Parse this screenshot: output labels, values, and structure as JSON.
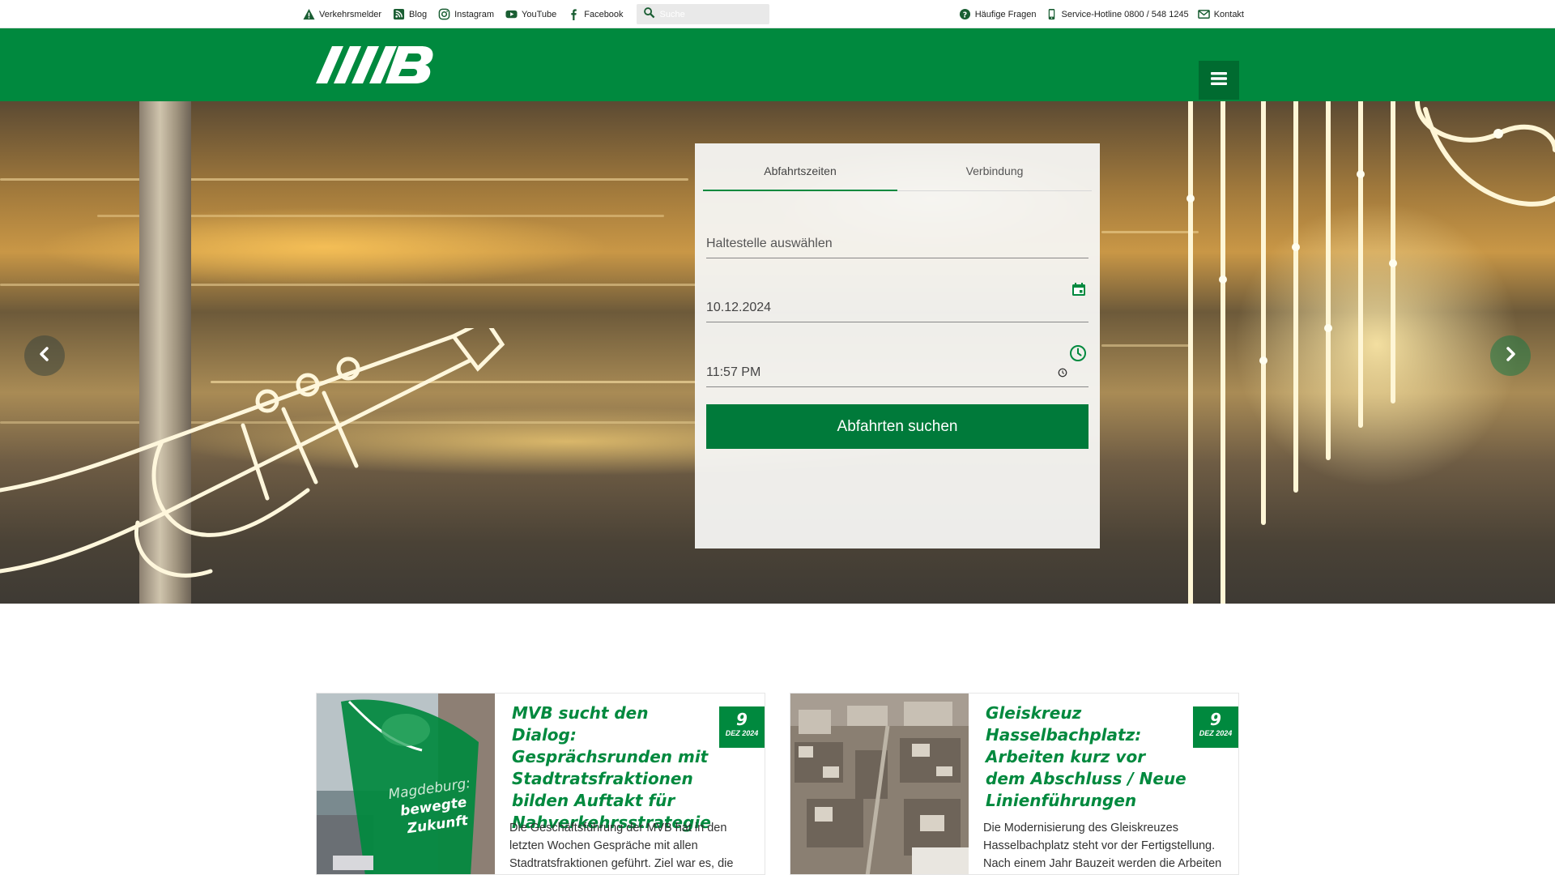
{
  "topbar": {
    "links_left": [
      {
        "label": "Verkehrsmelder",
        "icon": "warning-icon"
      },
      {
        "label": "Blog",
        "icon": "rss-icon"
      },
      {
        "label": "Instagram",
        "icon": "instagram-icon"
      },
      {
        "label": "YouTube",
        "icon": "youtube-icon"
      },
      {
        "label": "Facebook",
        "icon": "facebook-icon"
      }
    ],
    "search_placeholder": "Suche",
    "links_right": [
      {
        "label": "Häufige Fragen",
        "icon": "help-icon"
      },
      {
        "label": "Service-Hotline 0800 / 548 1245",
        "icon": "phone-icon"
      },
      {
        "label": "Kontakt",
        "icon": "mail-icon"
      }
    ]
  },
  "header": {
    "logo_text": "MVB",
    "brand_color": "#00893e"
  },
  "search_panel": {
    "tabs": [
      {
        "label": "Abfahrtszeiten",
        "active": true
      },
      {
        "label": "Verbindung",
        "active": false
      }
    ],
    "stop_placeholder": "Haltestelle auswählen",
    "date_value": "10.12.2024",
    "time_value": "11:57 PM",
    "submit_label": "Abfahrten suchen"
  },
  "news": [
    {
      "title": "MVB sucht den Dialog: Gesprächsrunden mit Stadtratsfraktionen bilden Auftakt für Nahverkehrsstrategie",
      "day": "9",
      "month_year": "DEZ 2024",
      "teaser": "Die Geschäftsführung der MVB hat in den letzten Wochen Gespräche mit allen Stadtratsfraktionen geführt. Ziel war es, die",
      "image_text": "Magdeburg: bewegte Zukunft"
    },
    {
      "title": "Gleiskreuz Hasselbachplatz: Arbeiten kurz vor dem Abschluss / Neue Linienführungen",
      "day": "9",
      "month_year": "DEZ 2024",
      "teaser": "Die Modernisierung des Gleiskreuzes Hasselbachplatz steht vor der Fertigstellung. Nach einem Jahr Bauzeit werden die Arbeiten"
    }
  ]
}
